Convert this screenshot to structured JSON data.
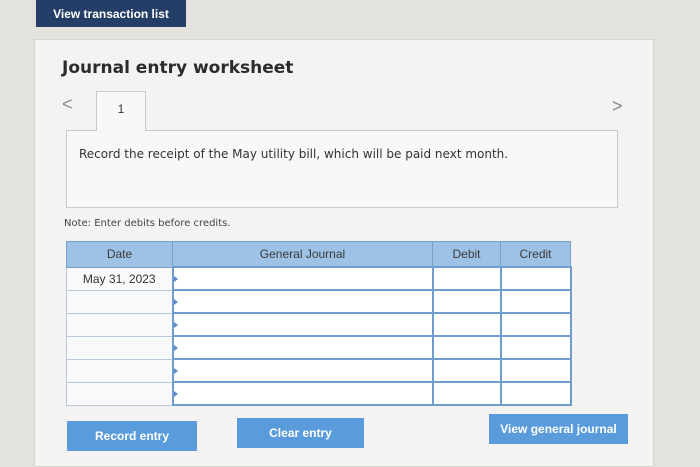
{
  "header": {
    "view_transactions_label": "View transaction list"
  },
  "worksheet": {
    "title": "Journal entry worksheet",
    "nav": {
      "prev_glyph": "<",
      "next_glyph": ">"
    },
    "active_tab": "1",
    "description": "Record the receipt of the May utility bill, which will be paid next month.",
    "note": "Note: Enter debits before credits."
  },
  "table": {
    "columns": [
      "Date",
      "General Journal",
      "Debit",
      "Credit"
    ],
    "rows": [
      {
        "date": "May 31, 2023",
        "account": "",
        "debit": "",
        "credit": ""
      },
      {
        "date": "",
        "account": "",
        "debit": "",
        "credit": ""
      },
      {
        "date": "",
        "account": "",
        "debit": "",
        "credit": ""
      },
      {
        "date": "",
        "account": "",
        "debit": "",
        "credit": ""
      },
      {
        "date": "",
        "account": "",
        "debit": "",
        "credit": ""
      },
      {
        "date": "",
        "account": "",
        "debit": "",
        "credit": ""
      }
    ]
  },
  "buttons": {
    "record": "Record entry",
    "clear": "Clear entry",
    "view_journal": "View general journal"
  },
  "colors": {
    "header_button_bg": "#253e67",
    "action_button_bg": "#5a9bdc",
    "table_header_bg": "#9ec1e6",
    "entry_border": "#6f9dd0"
  }
}
